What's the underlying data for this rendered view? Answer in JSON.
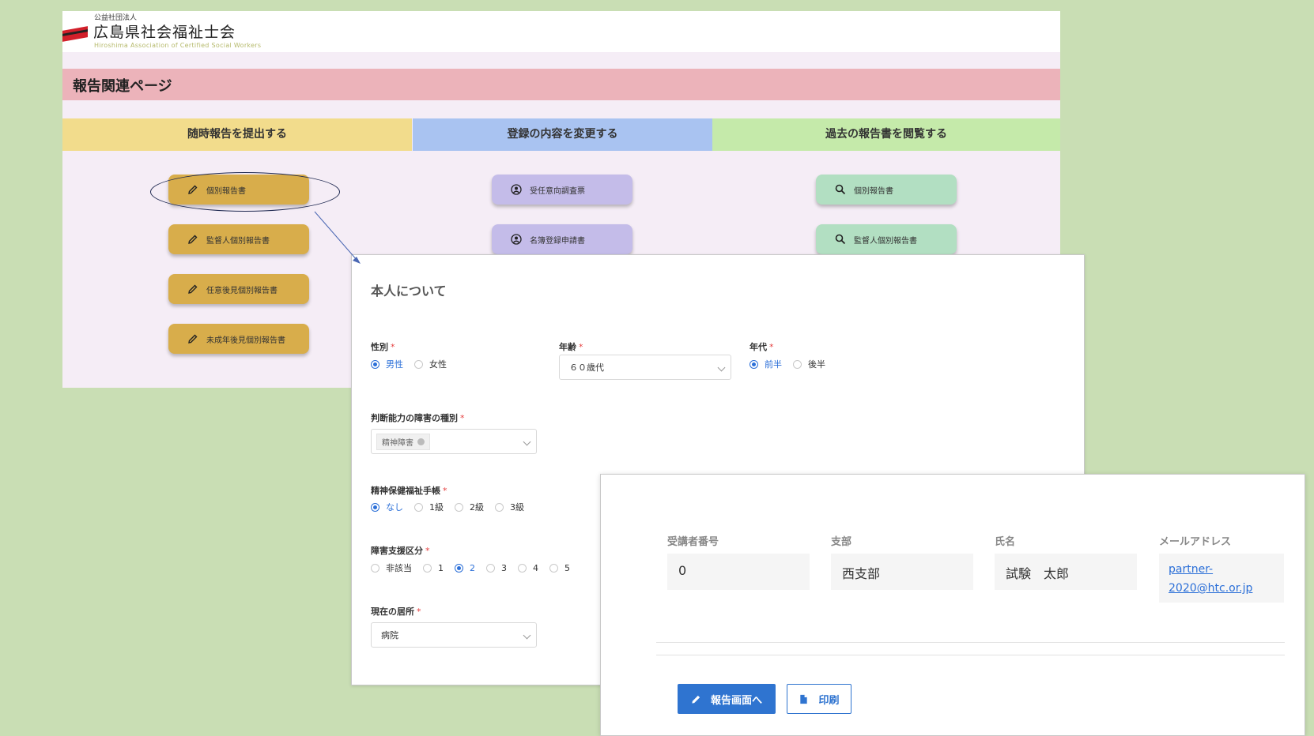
{
  "org": {
    "type_label": "公益社団法人",
    "name": "広島県社会福祉士会",
    "english_name": "Hiroshima Association of Certified Social Workers"
  },
  "report_page": {
    "title": "報告関連ページ",
    "columns": [
      {
        "heading": "随時報告を提出する",
        "color": "#f2dc8c",
        "buttons": [
          "個別報告書",
          "監督人個別報告書",
          "任意後見個別報告書",
          "未成年後見個別報告書"
        ],
        "icon": "pencil-icon"
      },
      {
        "heading": "登録の内容を変更する",
        "color": "#a9c3f1",
        "buttons": [
          "受任意向調査票",
          "名簿登録申請書"
        ],
        "icon": "user-circle-icon"
      },
      {
        "heading": "過去の報告書を閲覧する",
        "color": "#c5eaaa",
        "buttons": [
          "個別報告書",
          "監督人個別報告書"
        ],
        "icon": "search-icon"
      }
    ]
  },
  "person_form": {
    "section_title": "本人について",
    "fields": {
      "sex": {
        "label": "性別",
        "options": [
          "男性",
          "女性"
        ],
        "selected": "男性"
      },
      "age": {
        "label": "年齢",
        "value": "６０歳代"
      },
      "era": {
        "label": "年代",
        "options": [
          "前半",
          "後半"
        ],
        "selected": "前半"
      },
      "disability": {
        "label": "判断能力の障害の種別",
        "tag": "精神障害"
      },
      "handbook": {
        "label": "精神保健福祉手帳",
        "options": [
          "なし",
          "1級",
          "2級",
          "3級"
        ],
        "selected": "なし"
      },
      "support": {
        "label": "障害支援区分",
        "options": [
          "非該当",
          "1",
          "2",
          "3",
          "4",
          "5"
        ],
        "selected": "2"
      },
      "residence": {
        "label": "現在の居所",
        "value": "病院"
      }
    }
  },
  "applicant": {
    "fields": [
      {
        "label": "受講者番号",
        "value": "0"
      },
      {
        "label": "支部",
        "value": "西支部"
      },
      {
        "label": "氏名",
        "value": "試験　太郎"
      },
      {
        "label": "メールアドレス",
        "value": "partner-2020@htc.or.jp"
      }
    ],
    "buttons": {
      "report": "報告画面へ",
      "print": "印刷"
    }
  },
  "colors": {
    "background": "#c9deb4",
    "title_bar": "#ecb3ba",
    "gold_button": "#d8ad4b",
    "lavender_button": "#c4bce9",
    "mint_button": "#b2dfc2",
    "primary": "#2f74d0",
    "required": "#e53e3e"
  }
}
